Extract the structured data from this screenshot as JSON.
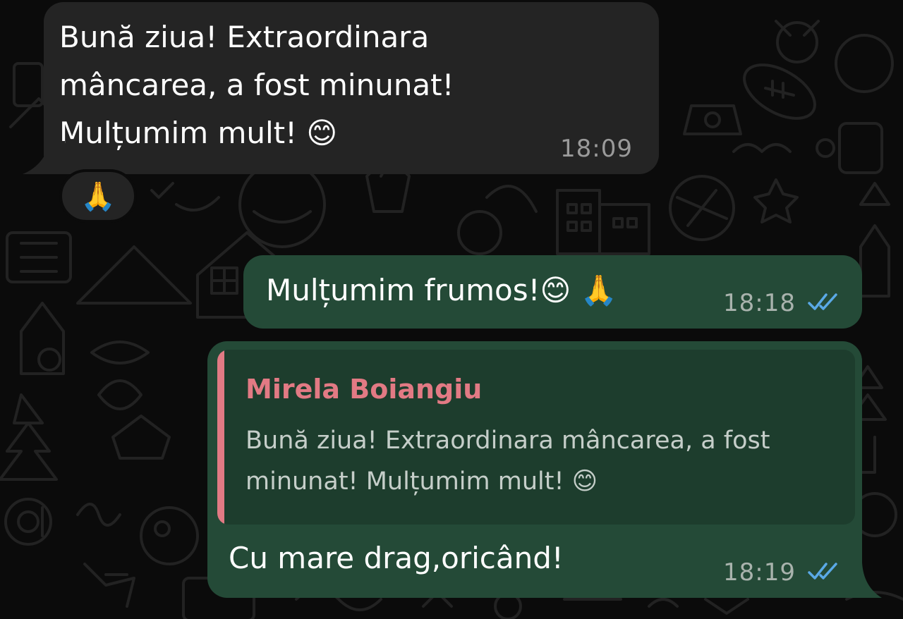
{
  "chat": {
    "messages": [
      {
        "direction": "incoming",
        "text": "Bună ziua! Extraordinara\nmâncarea, a fost minunat!\nMulțumim mult! 😊",
        "time": "18:09",
        "reaction": "🙏"
      },
      {
        "direction": "outgoing",
        "text": "Mulțumim frumos!😊 🙏",
        "time": "18:18",
        "status": "read"
      },
      {
        "direction": "outgoing",
        "reply_to": {
          "author": "Mirela Boiangiu",
          "text": "Bună ziua! Extraordinara mâncarea, a fost minunat! Mulțumim mult! 😊"
        },
        "text": "Cu mare drag,oricând!",
        "time": "18:19",
        "status": "read"
      }
    ]
  },
  "colors": {
    "background": "#0b0b0b",
    "incoming_bubble": "#242424",
    "outgoing_bubble": "#244a37",
    "quote_background": "#1d3d2d",
    "quote_author": "#e27a84",
    "read_ticks": "#5aa9e6",
    "wallpaper_doodle": "#1f1f1f"
  },
  "icons": {
    "read_receipt": "double-check-icon",
    "wallpaper": "doodle-pattern"
  }
}
